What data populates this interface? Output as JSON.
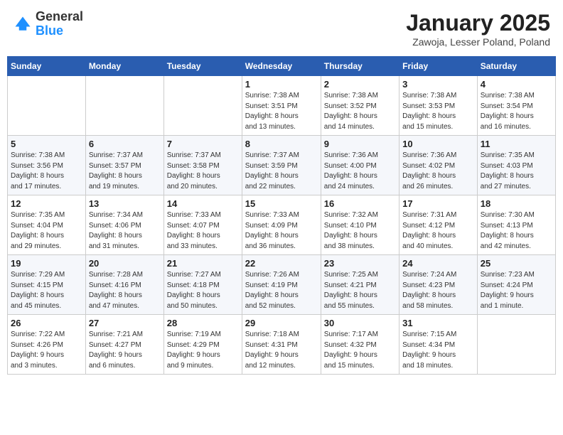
{
  "header": {
    "logo_general": "General",
    "logo_blue": "Blue",
    "month_title": "January 2025",
    "location": "Zawoja, Lesser Poland, Poland"
  },
  "weekdays": [
    "Sunday",
    "Monday",
    "Tuesday",
    "Wednesday",
    "Thursday",
    "Friday",
    "Saturday"
  ],
  "weeks": [
    [
      {
        "day": "",
        "info": ""
      },
      {
        "day": "",
        "info": ""
      },
      {
        "day": "",
        "info": ""
      },
      {
        "day": "1",
        "info": "Sunrise: 7:38 AM\nSunset: 3:51 PM\nDaylight: 8 hours\nand 13 minutes."
      },
      {
        "day": "2",
        "info": "Sunrise: 7:38 AM\nSunset: 3:52 PM\nDaylight: 8 hours\nand 14 minutes."
      },
      {
        "day": "3",
        "info": "Sunrise: 7:38 AM\nSunset: 3:53 PM\nDaylight: 8 hours\nand 15 minutes."
      },
      {
        "day": "4",
        "info": "Sunrise: 7:38 AM\nSunset: 3:54 PM\nDaylight: 8 hours\nand 16 minutes."
      }
    ],
    [
      {
        "day": "5",
        "info": "Sunrise: 7:38 AM\nSunset: 3:56 PM\nDaylight: 8 hours\nand 17 minutes."
      },
      {
        "day": "6",
        "info": "Sunrise: 7:37 AM\nSunset: 3:57 PM\nDaylight: 8 hours\nand 19 minutes."
      },
      {
        "day": "7",
        "info": "Sunrise: 7:37 AM\nSunset: 3:58 PM\nDaylight: 8 hours\nand 20 minutes."
      },
      {
        "day": "8",
        "info": "Sunrise: 7:37 AM\nSunset: 3:59 PM\nDaylight: 8 hours\nand 22 minutes."
      },
      {
        "day": "9",
        "info": "Sunrise: 7:36 AM\nSunset: 4:00 PM\nDaylight: 8 hours\nand 24 minutes."
      },
      {
        "day": "10",
        "info": "Sunrise: 7:36 AM\nSunset: 4:02 PM\nDaylight: 8 hours\nand 26 minutes."
      },
      {
        "day": "11",
        "info": "Sunrise: 7:35 AM\nSunset: 4:03 PM\nDaylight: 8 hours\nand 27 minutes."
      }
    ],
    [
      {
        "day": "12",
        "info": "Sunrise: 7:35 AM\nSunset: 4:04 PM\nDaylight: 8 hours\nand 29 minutes."
      },
      {
        "day": "13",
        "info": "Sunrise: 7:34 AM\nSunset: 4:06 PM\nDaylight: 8 hours\nand 31 minutes."
      },
      {
        "day": "14",
        "info": "Sunrise: 7:33 AM\nSunset: 4:07 PM\nDaylight: 8 hours\nand 33 minutes."
      },
      {
        "day": "15",
        "info": "Sunrise: 7:33 AM\nSunset: 4:09 PM\nDaylight: 8 hours\nand 36 minutes."
      },
      {
        "day": "16",
        "info": "Sunrise: 7:32 AM\nSunset: 4:10 PM\nDaylight: 8 hours\nand 38 minutes."
      },
      {
        "day": "17",
        "info": "Sunrise: 7:31 AM\nSunset: 4:12 PM\nDaylight: 8 hours\nand 40 minutes."
      },
      {
        "day": "18",
        "info": "Sunrise: 7:30 AM\nSunset: 4:13 PM\nDaylight: 8 hours\nand 42 minutes."
      }
    ],
    [
      {
        "day": "19",
        "info": "Sunrise: 7:29 AM\nSunset: 4:15 PM\nDaylight: 8 hours\nand 45 minutes."
      },
      {
        "day": "20",
        "info": "Sunrise: 7:28 AM\nSunset: 4:16 PM\nDaylight: 8 hours\nand 47 minutes."
      },
      {
        "day": "21",
        "info": "Sunrise: 7:27 AM\nSunset: 4:18 PM\nDaylight: 8 hours\nand 50 minutes."
      },
      {
        "day": "22",
        "info": "Sunrise: 7:26 AM\nSunset: 4:19 PM\nDaylight: 8 hours\nand 52 minutes."
      },
      {
        "day": "23",
        "info": "Sunrise: 7:25 AM\nSunset: 4:21 PM\nDaylight: 8 hours\nand 55 minutes."
      },
      {
        "day": "24",
        "info": "Sunrise: 7:24 AM\nSunset: 4:23 PM\nDaylight: 8 hours\nand 58 minutes."
      },
      {
        "day": "25",
        "info": "Sunrise: 7:23 AM\nSunset: 4:24 PM\nDaylight: 9 hours\nand 1 minute."
      }
    ],
    [
      {
        "day": "26",
        "info": "Sunrise: 7:22 AM\nSunset: 4:26 PM\nDaylight: 9 hours\nand 3 minutes."
      },
      {
        "day": "27",
        "info": "Sunrise: 7:21 AM\nSunset: 4:27 PM\nDaylight: 9 hours\nand 6 minutes."
      },
      {
        "day": "28",
        "info": "Sunrise: 7:19 AM\nSunset: 4:29 PM\nDaylight: 9 hours\nand 9 minutes."
      },
      {
        "day": "29",
        "info": "Sunrise: 7:18 AM\nSunset: 4:31 PM\nDaylight: 9 hours\nand 12 minutes."
      },
      {
        "day": "30",
        "info": "Sunrise: 7:17 AM\nSunset: 4:32 PM\nDaylight: 9 hours\nand 15 minutes."
      },
      {
        "day": "31",
        "info": "Sunrise: 7:15 AM\nSunset: 4:34 PM\nDaylight: 9 hours\nand 18 minutes."
      },
      {
        "day": "",
        "info": ""
      }
    ]
  ],
  "colors": {
    "header_bg": "#2a5db0",
    "accent": "#1e90ff"
  }
}
